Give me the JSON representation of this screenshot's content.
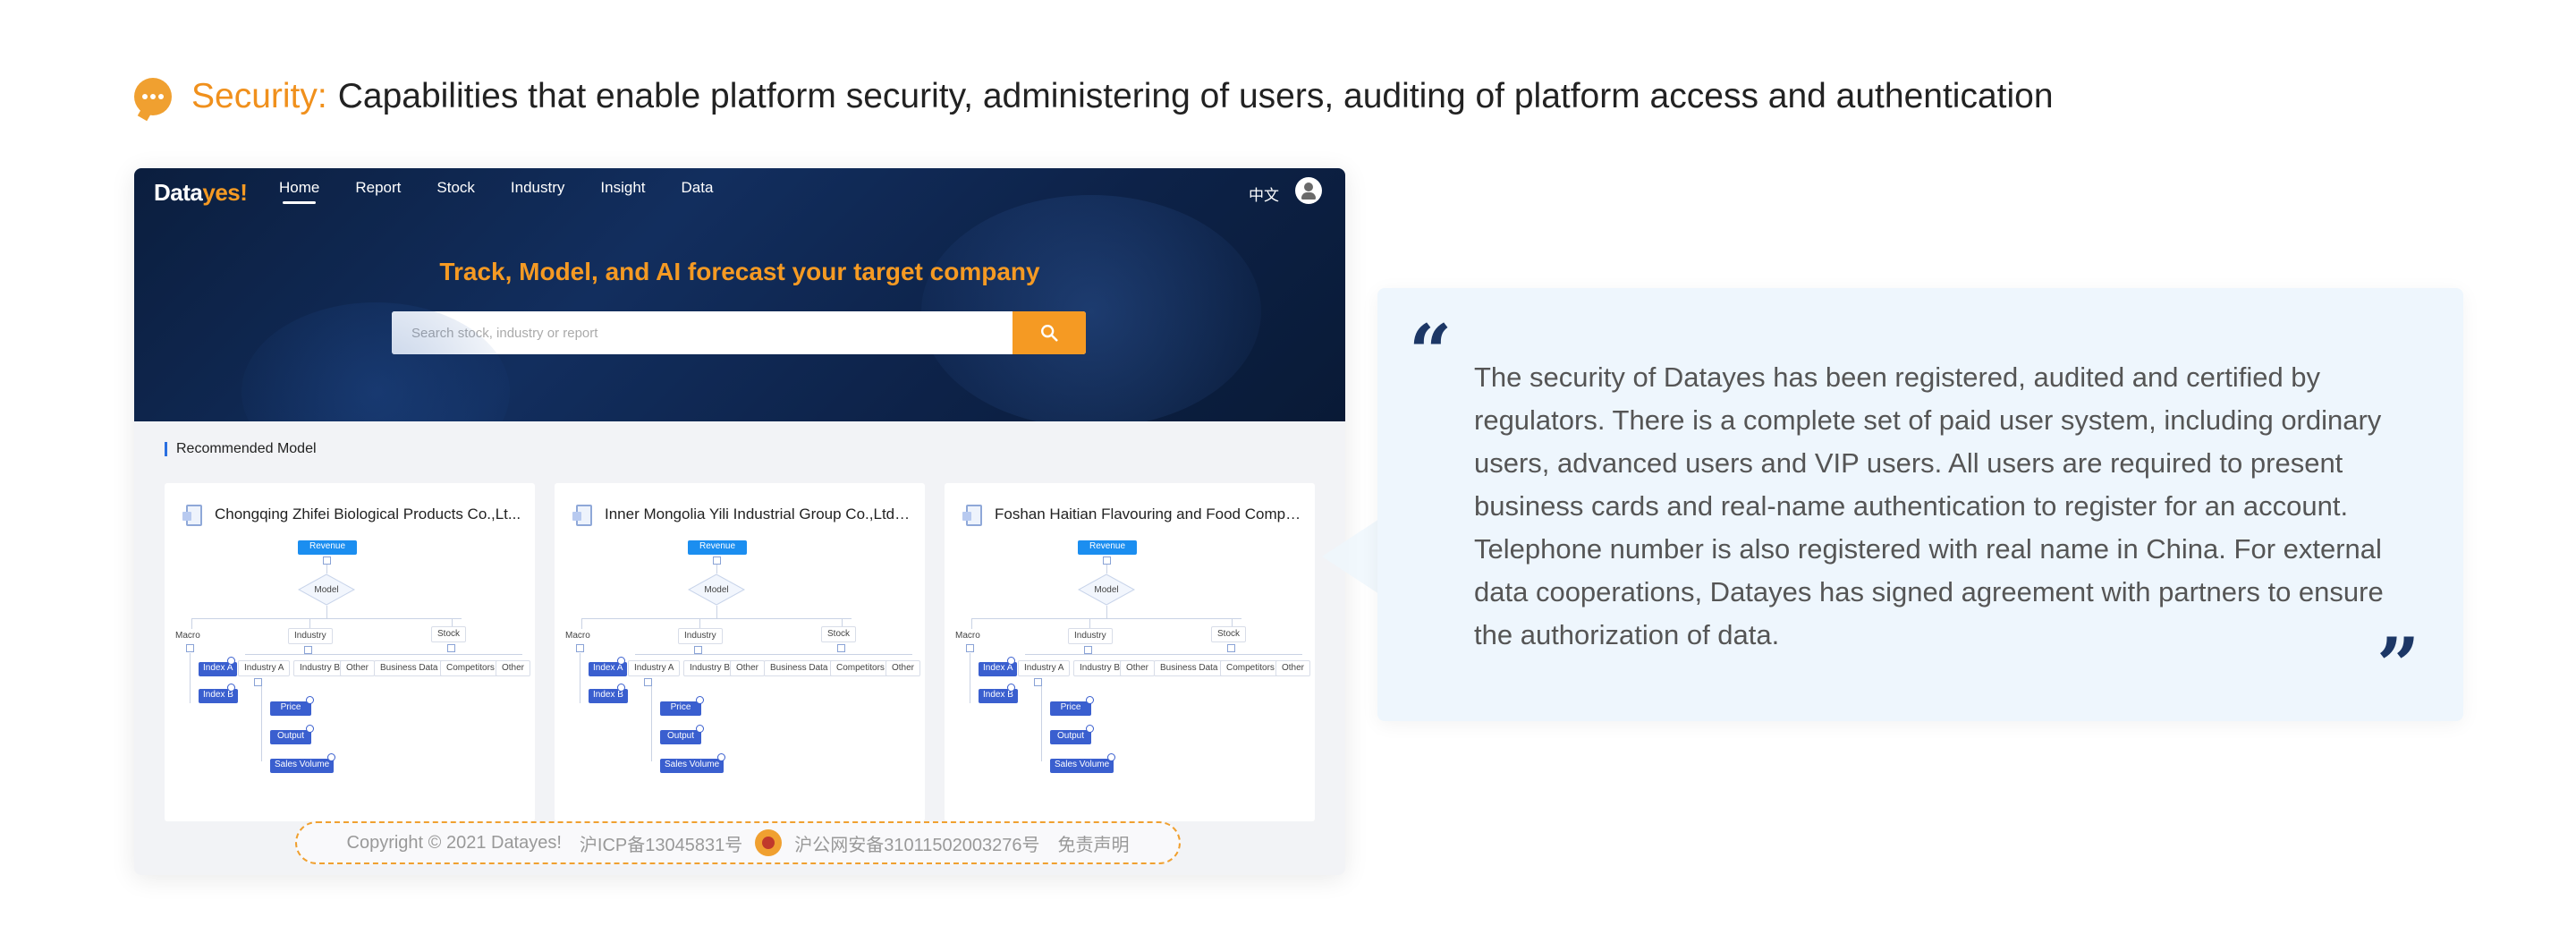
{
  "heading": {
    "label": "Security:",
    "text": "Capabilities that enable platform security, administering of users, auditing of platform access and authentication"
  },
  "app": {
    "logo_main": "Data",
    "logo_accent": "yes!",
    "nav": [
      "Home",
      "Report",
      "Stock",
      "Industry",
      "Insight",
      "Data"
    ],
    "active_nav": "Home",
    "language": "中文",
    "hero_title": "Track, Model, and AI forecast your target company",
    "search": {
      "placeholder": "Search stock, industry or report"
    },
    "section_label": "Recommended Model",
    "cards": [
      {
        "title": "Chongqing Zhifei Biological Products Co.,Lt..."
      },
      {
        "title": "Inner Mongolia Yili Industrial Group Co.,Ltd. ..."
      },
      {
        "title": "Foshan Haitian Flavouring and Food Compa..."
      }
    ],
    "tree": {
      "root": "Revenue",
      "model": "Model",
      "branches": [
        "Macro",
        "Industry",
        "Stock"
      ],
      "index_nodes": [
        "Index A",
        "Index B"
      ],
      "industry_nodes": [
        "Industry A",
        "Industry B",
        "Other",
        "Business Data",
        "Competitors",
        "Other"
      ],
      "sub_nodes": [
        "Price",
        "Output",
        "Sales Volume"
      ]
    },
    "footer": {
      "copyright": "Copyright © 2021 Datayes!",
      "icp": "沪ICP备13045831号",
      "police": "沪公网安备31011502003276号",
      "disclaimer": "免责声明"
    }
  },
  "quote": {
    "open_mark": "“",
    "close_mark": "”",
    "text": "The security of Datayes has been registered, audited and certified by regulators. There is a complete set of paid user system, including ordinary users, advanced users and VIP users. All users are required to present business cards and real-name authentication to register for an account. Telephone number is also registered with real name in China. For external data cooperations, Datayes has signed agreement with partners to ensure the authorization of data."
  },
  "colors": {
    "accent": "#f59a23",
    "hero_bg": "#0f2850",
    "quote_bg": "#eef6fd",
    "node_blue": "#1b8ef0",
    "node_dark": "#3a5fcf"
  }
}
